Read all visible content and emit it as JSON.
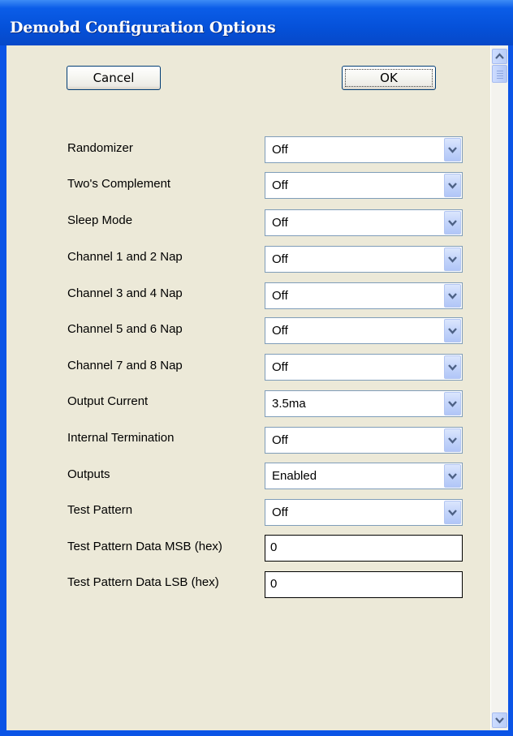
{
  "window": {
    "title": "Demobd Configuration Options"
  },
  "buttons": {
    "cancel_label": "Cancel",
    "ok_label": "OK"
  },
  "options": [
    {
      "label": "Randomizer",
      "value": "Off"
    },
    {
      "label": "Two's Complement",
      "value": "Off"
    },
    {
      "label": "Sleep Mode",
      "value": "Off"
    },
    {
      "label": "Channel 1 and 2 Nap",
      "value": "Off"
    },
    {
      "label": "Channel 3 and 4 Nap",
      "value": "Off"
    },
    {
      "label": "Channel 5 and 6 Nap",
      "value": "Off"
    },
    {
      "label": "Channel 7 and 8 Nap",
      "value": "Off"
    },
    {
      "label": "Output Current",
      "value": "3.5ma"
    },
    {
      "label": "Internal Termination",
      "value": "Off"
    },
    {
      "label": "Outputs",
      "value": "Enabled"
    },
    {
      "label": "Test Pattern",
      "value": "Off"
    }
  ],
  "text_fields": [
    {
      "label": "Test Pattern Data MSB (hex)",
      "value": "0"
    },
    {
      "label": "Test Pattern Data LSB (hex)",
      "value": "0"
    }
  ],
  "icons": {
    "scroll_up": "scroll-up-arrow-icon",
    "scroll_down": "scroll-down-arrow-icon",
    "dropdown": "chevron-down-icon"
  },
  "colors": {
    "titlebar": "#0551d9",
    "client_background": "#ece9d8",
    "title_text": "#ffffff"
  }
}
